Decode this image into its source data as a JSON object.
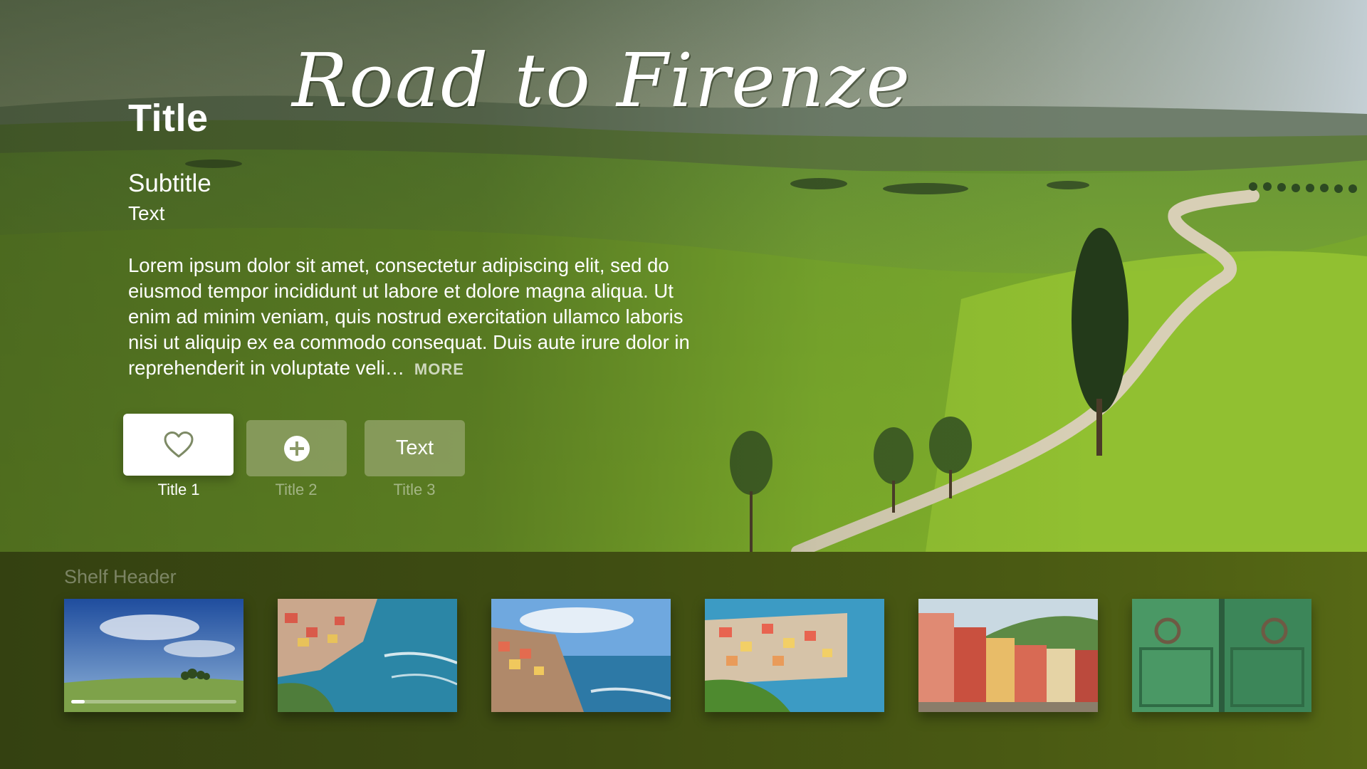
{
  "hero": {
    "logo_title": "Road to Firenze",
    "title": "Title",
    "subtitle": "Subtitle",
    "subtext": "Text",
    "description": "Lorem ipsum dolor sit amet, consectetur adipiscing elit, sed do eiusmod tempor incididunt ut labore et dolore magna aliqua. Ut enim ad minim veniam, quis nostrud exercitation ullamco laboris nisi ut aliquip ex ea commodo consequat. Duis aute irure dolor in reprehenderit in voluptate veli…",
    "more_label": "MORE"
  },
  "buttons": [
    {
      "icon": "heart-icon",
      "caption": "Title 1",
      "focused": true
    },
    {
      "icon": "plus-circle-icon",
      "caption": "Title 2",
      "focused": false
    },
    {
      "label": "Text",
      "caption": "Title 3",
      "focused": false
    }
  ],
  "shelf": {
    "header": "Shelf Header",
    "items": [
      {
        "image": "green hill under blue sky",
        "progress": 0.08
      },
      {
        "image": "coastal village with harbor"
      },
      {
        "image": "cliffside village by the sea"
      },
      {
        "image": "colorful village on hillside"
      },
      {
        "image": "colorful buildings by the water"
      },
      {
        "image": "green wooden door with ring knockers"
      }
    ]
  },
  "colors": {
    "shelf_background": "#3e4c12",
    "focused_button": "#ffffff",
    "unfocused_button": "#96a56e"
  }
}
